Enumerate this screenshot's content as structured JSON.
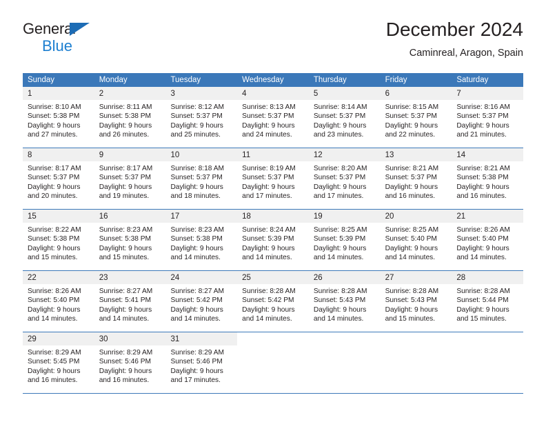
{
  "brand": {
    "name_top": "General",
    "name_bottom": "Blue",
    "accent_dark": "#1d6cb5",
    "accent_light": "#1d7fd0"
  },
  "header": {
    "title": "December 2024",
    "subtitle": "Caminreal, Aragon, Spain"
  },
  "theme": {
    "header_blue": "#3b78b9",
    "day_band_gray": "#f0f0f0",
    "text": "#231f20"
  },
  "weekdays": [
    "Sunday",
    "Monday",
    "Tuesday",
    "Wednesday",
    "Thursday",
    "Friday",
    "Saturday"
  ],
  "weeks": [
    [
      {
        "day": "1",
        "sunrise": "Sunrise: 8:10 AM",
        "sunset": "Sunset: 5:38 PM",
        "daylight1": "Daylight: 9 hours",
        "daylight2": "and 27 minutes."
      },
      {
        "day": "2",
        "sunrise": "Sunrise: 8:11 AM",
        "sunset": "Sunset: 5:38 PM",
        "daylight1": "Daylight: 9 hours",
        "daylight2": "and 26 minutes."
      },
      {
        "day": "3",
        "sunrise": "Sunrise: 8:12 AM",
        "sunset": "Sunset: 5:37 PM",
        "daylight1": "Daylight: 9 hours",
        "daylight2": "and 25 minutes."
      },
      {
        "day": "4",
        "sunrise": "Sunrise: 8:13 AM",
        "sunset": "Sunset: 5:37 PM",
        "daylight1": "Daylight: 9 hours",
        "daylight2": "and 24 minutes."
      },
      {
        "day": "5",
        "sunrise": "Sunrise: 8:14 AM",
        "sunset": "Sunset: 5:37 PM",
        "daylight1": "Daylight: 9 hours",
        "daylight2": "and 23 minutes."
      },
      {
        "day": "6",
        "sunrise": "Sunrise: 8:15 AM",
        "sunset": "Sunset: 5:37 PM",
        "daylight1": "Daylight: 9 hours",
        "daylight2": "and 22 minutes."
      },
      {
        "day": "7",
        "sunrise": "Sunrise: 8:16 AM",
        "sunset": "Sunset: 5:37 PM",
        "daylight1": "Daylight: 9 hours",
        "daylight2": "and 21 minutes."
      }
    ],
    [
      {
        "day": "8",
        "sunrise": "Sunrise: 8:17 AM",
        "sunset": "Sunset: 5:37 PM",
        "daylight1": "Daylight: 9 hours",
        "daylight2": "and 20 minutes."
      },
      {
        "day": "9",
        "sunrise": "Sunrise: 8:17 AM",
        "sunset": "Sunset: 5:37 PM",
        "daylight1": "Daylight: 9 hours",
        "daylight2": "and 19 minutes."
      },
      {
        "day": "10",
        "sunrise": "Sunrise: 8:18 AM",
        "sunset": "Sunset: 5:37 PM",
        "daylight1": "Daylight: 9 hours",
        "daylight2": "and 18 minutes."
      },
      {
        "day": "11",
        "sunrise": "Sunrise: 8:19 AM",
        "sunset": "Sunset: 5:37 PM",
        "daylight1": "Daylight: 9 hours",
        "daylight2": "and 17 minutes."
      },
      {
        "day": "12",
        "sunrise": "Sunrise: 8:20 AM",
        "sunset": "Sunset: 5:37 PM",
        "daylight1": "Daylight: 9 hours",
        "daylight2": "and 17 minutes."
      },
      {
        "day": "13",
        "sunrise": "Sunrise: 8:21 AM",
        "sunset": "Sunset: 5:37 PM",
        "daylight1": "Daylight: 9 hours",
        "daylight2": "and 16 minutes."
      },
      {
        "day": "14",
        "sunrise": "Sunrise: 8:21 AM",
        "sunset": "Sunset: 5:38 PM",
        "daylight1": "Daylight: 9 hours",
        "daylight2": "and 16 minutes."
      }
    ],
    [
      {
        "day": "15",
        "sunrise": "Sunrise: 8:22 AM",
        "sunset": "Sunset: 5:38 PM",
        "daylight1": "Daylight: 9 hours",
        "daylight2": "and 15 minutes."
      },
      {
        "day": "16",
        "sunrise": "Sunrise: 8:23 AM",
        "sunset": "Sunset: 5:38 PM",
        "daylight1": "Daylight: 9 hours",
        "daylight2": "and 15 minutes."
      },
      {
        "day": "17",
        "sunrise": "Sunrise: 8:23 AM",
        "sunset": "Sunset: 5:38 PM",
        "daylight1": "Daylight: 9 hours",
        "daylight2": "and 14 minutes."
      },
      {
        "day": "18",
        "sunrise": "Sunrise: 8:24 AM",
        "sunset": "Sunset: 5:39 PM",
        "daylight1": "Daylight: 9 hours",
        "daylight2": "and 14 minutes."
      },
      {
        "day": "19",
        "sunrise": "Sunrise: 8:25 AM",
        "sunset": "Sunset: 5:39 PM",
        "daylight1": "Daylight: 9 hours",
        "daylight2": "and 14 minutes."
      },
      {
        "day": "20",
        "sunrise": "Sunrise: 8:25 AM",
        "sunset": "Sunset: 5:40 PM",
        "daylight1": "Daylight: 9 hours",
        "daylight2": "and 14 minutes."
      },
      {
        "day": "21",
        "sunrise": "Sunrise: 8:26 AM",
        "sunset": "Sunset: 5:40 PM",
        "daylight1": "Daylight: 9 hours",
        "daylight2": "and 14 minutes."
      }
    ],
    [
      {
        "day": "22",
        "sunrise": "Sunrise: 8:26 AM",
        "sunset": "Sunset: 5:40 PM",
        "daylight1": "Daylight: 9 hours",
        "daylight2": "and 14 minutes."
      },
      {
        "day": "23",
        "sunrise": "Sunrise: 8:27 AM",
        "sunset": "Sunset: 5:41 PM",
        "daylight1": "Daylight: 9 hours",
        "daylight2": "and 14 minutes."
      },
      {
        "day": "24",
        "sunrise": "Sunrise: 8:27 AM",
        "sunset": "Sunset: 5:42 PM",
        "daylight1": "Daylight: 9 hours",
        "daylight2": "and 14 minutes."
      },
      {
        "day": "25",
        "sunrise": "Sunrise: 8:28 AM",
        "sunset": "Sunset: 5:42 PM",
        "daylight1": "Daylight: 9 hours",
        "daylight2": "and 14 minutes."
      },
      {
        "day": "26",
        "sunrise": "Sunrise: 8:28 AM",
        "sunset": "Sunset: 5:43 PM",
        "daylight1": "Daylight: 9 hours",
        "daylight2": "and 14 minutes."
      },
      {
        "day": "27",
        "sunrise": "Sunrise: 8:28 AM",
        "sunset": "Sunset: 5:43 PM",
        "daylight1": "Daylight: 9 hours",
        "daylight2": "and 15 minutes."
      },
      {
        "day": "28",
        "sunrise": "Sunrise: 8:28 AM",
        "sunset": "Sunset: 5:44 PM",
        "daylight1": "Daylight: 9 hours",
        "daylight2": "and 15 minutes."
      }
    ],
    [
      {
        "day": "29",
        "sunrise": "Sunrise: 8:29 AM",
        "sunset": "Sunset: 5:45 PM",
        "daylight1": "Daylight: 9 hours",
        "daylight2": "and 16 minutes."
      },
      {
        "day": "30",
        "sunrise": "Sunrise: 8:29 AM",
        "sunset": "Sunset: 5:46 PM",
        "daylight1": "Daylight: 9 hours",
        "daylight2": "and 16 minutes."
      },
      {
        "day": "31",
        "sunrise": "Sunrise: 8:29 AM",
        "sunset": "Sunset: 5:46 PM",
        "daylight1": "Daylight: 9 hours",
        "daylight2": "and 17 minutes."
      },
      {
        "day": "",
        "sunrise": "",
        "sunset": "",
        "daylight1": "",
        "daylight2": ""
      },
      {
        "day": "",
        "sunrise": "",
        "sunset": "",
        "daylight1": "",
        "daylight2": ""
      },
      {
        "day": "",
        "sunrise": "",
        "sunset": "",
        "daylight1": "",
        "daylight2": ""
      },
      {
        "day": "",
        "sunrise": "",
        "sunset": "",
        "daylight1": "",
        "daylight2": ""
      }
    ]
  ]
}
